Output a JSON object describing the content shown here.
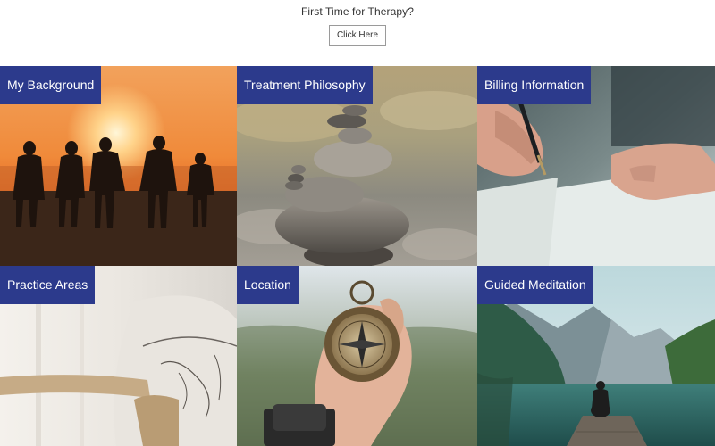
{
  "header": {
    "prompt": "First Time for Therapy?",
    "button_label": "Click Here"
  },
  "tiles": [
    {
      "label": "My Background",
      "image": "family-sunset-beach"
    },
    {
      "label": "Treatment Philosophy",
      "image": "stacked-stones"
    },
    {
      "label": "Billing Information",
      "image": "hand-writing-pen"
    },
    {
      "label": "Practice Areas",
      "image": "armchair-window"
    },
    {
      "label": "Location",
      "image": "hand-holding-compass"
    },
    {
      "label": "Guided Meditation",
      "image": "person-on-dock-lake-mountains"
    }
  ],
  "colors": {
    "label_bg": "#2c3a8c",
    "label_text": "#ffffff"
  }
}
